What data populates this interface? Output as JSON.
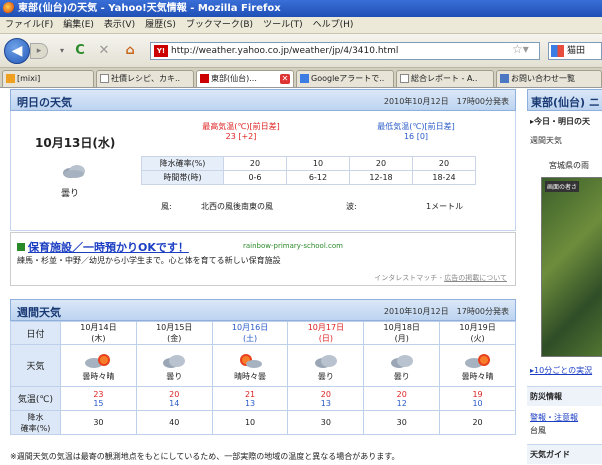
{
  "window": {
    "title": "東部(仙台)の天気 - Yahoo!天気情報 - Mozilla Firefox"
  },
  "menu": [
    "ファイル(F)",
    "編集(E)",
    "表示(V)",
    "履歴(S)",
    "ブックマーク(B)",
    "ツール(T)",
    "ヘルプ(H)"
  ],
  "nav": {
    "url": "http://weather.yahoo.co.jp/weather/jp/4/3410.html",
    "favicon": "Y!",
    "search": "猫田"
  },
  "tabs": [
    "[mixi]",
    "社價レシピ、カキ..",
    "東部(仙台)...",
    "Googleアラートで..",
    "総合レポート - A..",
    "お問い合わせ一覧"
  ],
  "tomorrow": {
    "title": "明日の天気",
    "published": "2010年10月12日　17時00分発表",
    "date": "10月13日(水)",
    "weather": "曇り",
    "high_label": "最高気温(℃)[前日差]",
    "high_value": "23 [+2]",
    "low_label": "最低気温(℃)[前日差]",
    "low_value": "16 [0]",
    "rain_label": "降水確率(%)",
    "rain_values": [
      "20",
      "10",
      "20",
      "20"
    ],
    "time_label": "時間帯(時)",
    "time_values": [
      "0-6",
      "6-12",
      "12-18",
      "18-24"
    ],
    "wind_label": "風:",
    "wind_value": "北西の風後南東の風",
    "wave_label": "波:",
    "wave_value": "1メートル"
  },
  "ad": {
    "title": "保育施設／一時預かりOKです！",
    "url": "rainbow-primary-school.com",
    "desc": "練馬・杉並・中野／幼児から小学生まで。心と体を育てる新しい保育施設",
    "foot": "インタレストマッチ",
    "sep": " - ",
    "foot_link": "広告の掲載について"
  },
  "weekly": {
    "title": "週間天気",
    "published": "2010年10月12日　17時00分発表",
    "row_labels": {
      "date": "日付",
      "weather": "天気",
      "temp": "気温(℃)",
      "rain": "降水\n確率(%)"
    },
    "days": [
      {
        "date": "10月14日",
        "dow": "(木)",
        "weather": "曇時々晴",
        "icon": "sun-cloud-icon",
        "high": "23",
        "low": "15",
        "rain": "30"
      },
      {
        "date": "10月15日",
        "dow": "(金)",
        "weather": "曇り",
        "icon": "cloud-icon",
        "high": "20",
        "low": "14",
        "rain": "40"
      },
      {
        "date": "10月16日",
        "dow": "(土)",
        "weather": "晴時々曇",
        "icon": "sun-cloud-icon",
        "high": "21",
        "low": "13",
        "rain": "10"
      },
      {
        "date": "10月17日",
        "dow": "(日)",
        "weather": "曇り",
        "icon": "cloud-icon",
        "high": "20",
        "low": "13",
        "rain": "30"
      },
      {
        "date": "10月18日",
        "dow": "(月)",
        "weather": "曇り",
        "icon": "cloud-icon",
        "high": "20",
        "low": "12",
        "rain": "30"
      },
      {
        "date": "10月19日",
        "dow": "(火)",
        "weather": "曇時々晴",
        "icon": "sun-cloud-icon",
        "high": "19",
        "low": "10",
        "rain": "20"
      }
    ],
    "note": "※週間天気の気温は最寄の観測地点をもとにしているため、一部実際の地域の温度と異なる場合があります。"
  },
  "side": {
    "title": "東部(仙台) ニ",
    "today_link": "▸今日・明日の天",
    "weekly_link": "週間天気",
    "pref": "宮城県の雨",
    "map_label": "画面の者さ",
    "ten_min": "▸10分ごとの実況",
    "disaster": "防災情報",
    "warning": "警報・注意報",
    "typhoon": "台風",
    "guide": "天気ガイド"
  }
}
